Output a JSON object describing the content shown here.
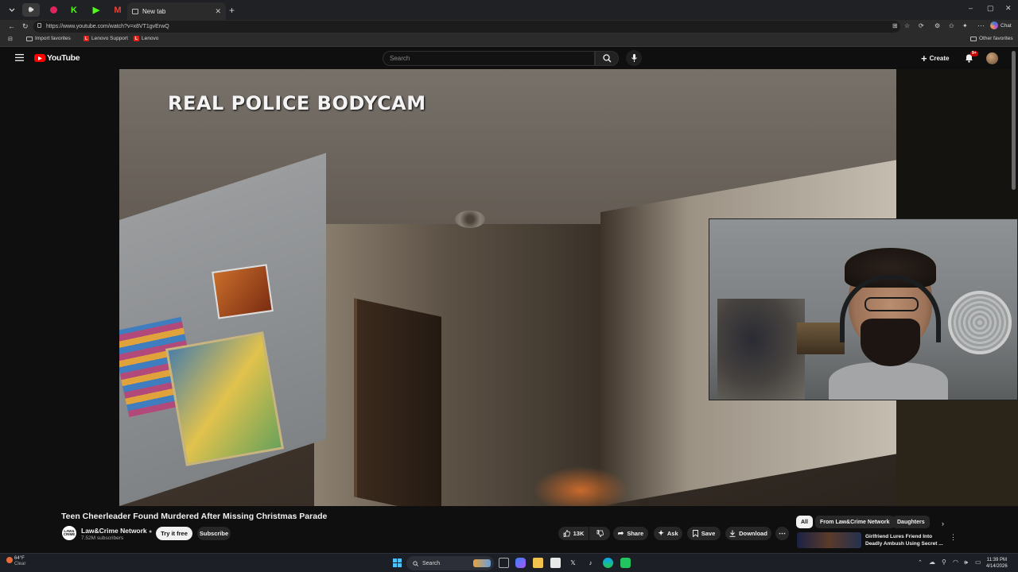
{
  "browser": {
    "tab_title": "New tab",
    "url": "https://www.youtube.com/watch?v=x8VT1gvErwQ",
    "favorites": [
      "Import favorites",
      "Lenovo Support",
      "Lenovo"
    ],
    "other_favorites": "Other favorites",
    "chat_label": "Chat"
  },
  "youtube": {
    "logo_text": "YouTube",
    "search_placeholder": "Search",
    "create_label": "Create",
    "notif_badge": "9+"
  },
  "player": {
    "overlay_text": "REAL POLICE BODYCAM"
  },
  "video": {
    "title": "Teen Cheerleader Found Murdered After Missing Christmas Parade",
    "channel_name": "Law&Crime Network",
    "channel_avatar_text": "LAW& CRIME",
    "subscribers": "7.52M subscribers",
    "try_label": "Try it free",
    "subscribe_label": "Subscribe",
    "likes": "13K",
    "share_label": "Share",
    "ask_label": "Ask",
    "save_label": "Save",
    "download_label": "Download"
  },
  "sidebar_right": {
    "chips": [
      "All",
      "From Law&Crime Network",
      "Daughters"
    ],
    "recommended_title": "Girlfriend Lures Friend Into Deadly Ambush Using Secret ..."
  },
  "taskbar": {
    "weather_temp": "64°F",
    "weather_desc": "Clear",
    "search_label": "Search",
    "time": "11:39 PM",
    "date": "4/14/2026"
  }
}
